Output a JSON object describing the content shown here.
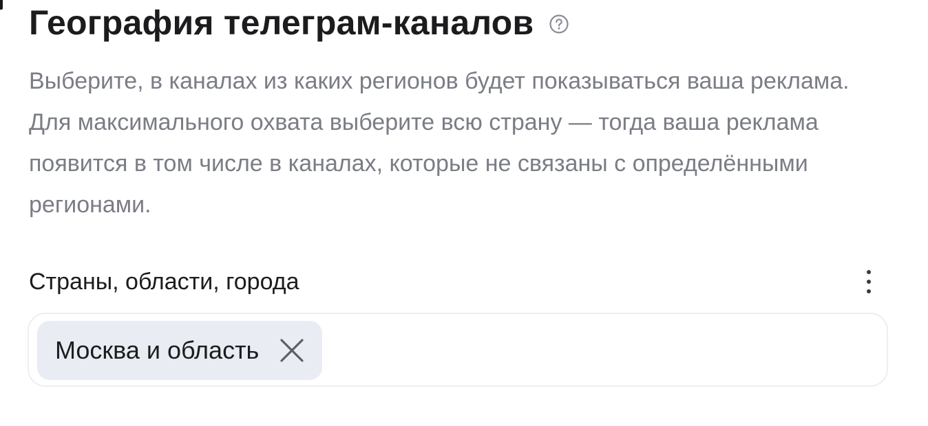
{
  "section": {
    "title": "География телеграм-каналов",
    "help_icon": "question-circle-icon",
    "description": "Выберите, в каналах из каких регионов будет показываться ваша реклама. Для максимального охвата выберите всю страну — тогда ваша реклама появится в том числе в каналах, которые не связаны с определёнными регионами."
  },
  "field": {
    "label": "Страны, области, города",
    "more_icon": "vertical-dots-icon",
    "chips": [
      {
        "label": "Москва и область",
        "remove_icon": "close-icon"
      }
    ]
  },
  "colors": {
    "title": "#1c1c1e",
    "description": "#7a7d85",
    "chip_background": "#e9ecf2",
    "field_border": "#eceef2"
  }
}
